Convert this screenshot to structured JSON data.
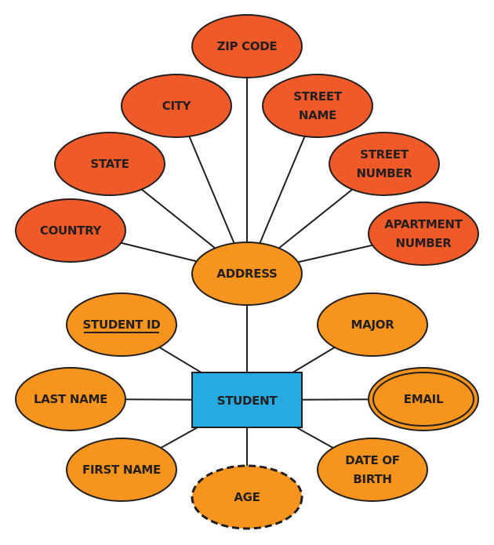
{
  "colors": {
    "address_attribute": "#F05A28",
    "student_attribute": "#F7941D",
    "entity": "#27AAE1",
    "stroke": "#231F20"
  },
  "entity": {
    "label": "STUDENT"
  },
  "address": {
    "label": "ADDRESS",
    "attributes": [
      {
        "id": "zip-code",
        "lines": [
          "ZIP CODE"
        ]
      },
      {
        "id": "city",
        "lines": [
          "CITY"
        ]
      },
      {
        "id": "state",
        "lines": [
          "STATE"
        ]
      },
      {
        "id": "country",
        "lines": [
          "COUNTRY"
        ]
      },
      {
        "id": "street-name",
        "lines": [
          "STREET",
          "NAME"
        ]
      },
      {
        "id": "street-number",
        "lines": [
          "STREET",
          "NUMBER"
        ]
      },
      {
        "id": "apartment-number",
        "lines": [
          "APARTMENT",
          "NUMBER"
        ]
      }
    ]
  },
  "student_attributes": [
    {
      "id": "student-id",
      "lines": [
        "STUDENT ID"
      ],
      "kind": "key"
    },
    {
      "id": "major",
      "lines": [
        "MAJOR"
      ],
      "kind": "simple"
    },
    {
      "id": "last-name",
      "lines": [
        "LAST NAME"
      ],
      "kind": "simple"
    },
    {
      "id": "email",
      "lines": [
        "EMAIL"
      ],
      "kind": "multivalued"
    },
    {
      "id": "first-name",
      "lines": [
        "FIRST NAME"
      ],
      "kind": "simple"
    },
    {
      "id": "age",
      "lines": [
        "AGE"
      ],
      "kind": "derived"
    },
    {
      "id": "date-of-birth",
      "lines": [
        "DATE OF",
        "BIRTH"
      ],
      "kind": "simple"
    }
  ]
}
